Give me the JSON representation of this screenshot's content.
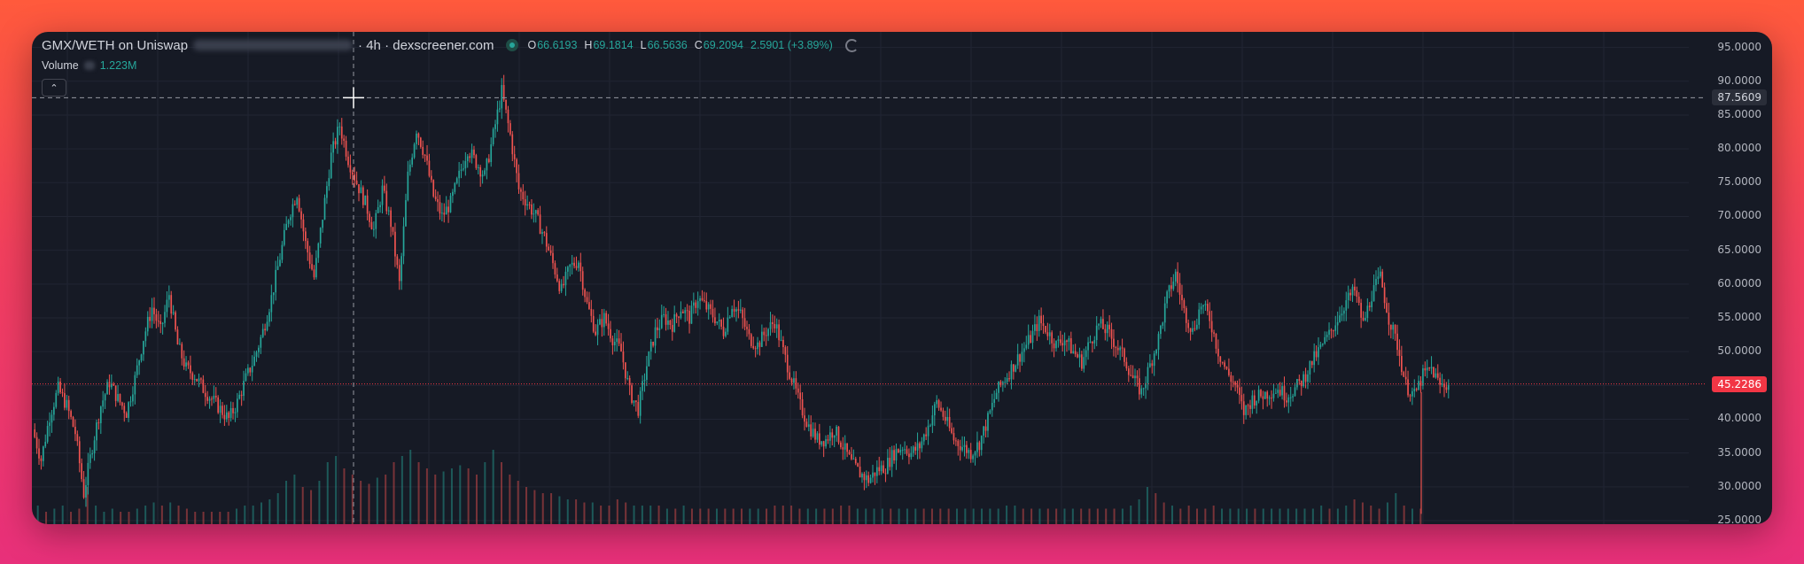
{
  "header": {
    "pair": "GMX/WETH on Uniswap",
    "timeframe": "4h",
    "source": "dexscreener.com",
    "ohlc": {
      "open_label": "O",
      "open": "66.6193",
      "high_label": "H",
      "high": "69.1814",
      "low_label": "L",
      "low": "66.5636",
      "close_label": "C",
      "close": "69.2094",
      "change": "2.5901 (+3.89%)"
    }
  },
  "volume": {
    "label": "Volume",
    "value": "1.223M"
  },
  "colors": {
    "up": "#26a69a",
    "down": "#ef5350",
    "background": "#161a25",
    "grid": "#212533",
    "price_line": "#f23645"
  },
  "crosshair_price": "87.5609",
  "last_price": "45.2286",
  "chart_data": {
    "type": "candlestick",
    "ylim": [
      25,
      96
    ],
    "y_ticks": [
      "95.0000",
      "90.0000",
      "85.0000",
      "80.0000",
      "75.0000",
      "70.0000",
      "65.0000",
      "60.0000",
      "55.0000",
      "50.0000",
      "45.0000",
      "40.0000",
      "35.0000",
      "30.0000",
      "25.0000"
    ],
    "series": [
      {
        "values": [
          38.5,
          34.0,
          40.5,
          44.5,
          42.0,
          38.0,
          29.0,
          36.0,
          42.0,
          45.5,
          43.0,
          41.0,
          46.0,
          52.0,
          56.5,
          53.0,
          58.5,
          51.0,
          47.5,
          46.5,
          44.5,
          43.0,
          41.5,
          40.0,
          42.5,
          46.0,
          49.0,
          53.0,
          58.0,
          64.0,
          70.0,
          73.5,
          66.0,
          61.0,
          70.0,
          79.0,
          83.5,
          78.5,
          75.0,
          72.0,
          68.0,
          74.0,
          69.0,
          60.0,
          76.0,
          83.0,
          79.0,
          73.0,
          70.0,
          72.0,
          76.0,
          80.0,
          78.0,
          76.0,
          82.0,
          88.5,
          82.0,
          74.0,
          72.0,
          70.0,
          67.0,
          63.0,
          59.0,
          62.5,
          63.5,
          57.0,
          53.0,
          55.0,
          52.0,
          50.0,
          44.0,
          41.5,
          48.0,
          53.0,
          55.0,
          54.0,
          56.5,
          55.0,
          58.0,
          56.5,
          55.0,
          53.0,
          57.0,
          55.5,
          52.0,
          51.0,
          53.0,
          54.5,
          50.0,
          46.0,
          42.0,
          39.0,
          37.0,
          37.0,
          38.5,
          36.0,
          33.5,
          32.0,
          31.0,
          32.5,
          33.0,
          35.0,
          36.0,
          35.0,
          36.0,
          39.0,
          42.5,
          40.0,
          37.0,
          36.0,
          35.0,
          36.5,
          40.0,
          44.0,
          46.0,
          48.0,
          50.0,
          52.0,
          54.5,
          53.0,
          51.0,
          52.0,
          50.0,
          48.5,
          51.5,
          54.0,
          53.0,
          51.0,
          49.0,
          46.0,
          44.0,
          48.0,
          52.0,
          58.0,
          61.5,
          56.0,
          53.0,
          57.0,
          55.0,
          50.0,
          47.0,
          45.0,
          41.0,
          43.0,
          43.5,
          44.0,
          44.5,
          43.5,
          44.5,
          46.0,
          48.5,
          50.5,
          52.5,
          55.0,
          57.5,
          59.0,
          54.0,
          58.5,
          61.0,
          55.0,
          51.0,
          45.0,
          43.5,
          46.5,
          47.5,
          45.0,
          45.2
        ]
      }
    ],
    "volume_values": [
      0.3,
      0.2,
      0.25,
      0.3,
      0.2,
      0.25,
      0.6,
      0.3,
      0.2,
      0.25,
      0.2,
      0.2,
      0.25,
      0.3,
      0.35,
      0.3,
      0.35,
      0.3,
      0.25,
      0.2,
      0.2,
      0.2,
      0.2,
      0.2,
      0.25,
      0.3,
      0.3,
      0.35,
      0.4,
      0.5,
      0.7,
      0.8,
      0.6,
      0.55,
      0.7,
      1.0,
      1.1,
      0.9,
      0.8,
      0.7,
      0.65,
      0.75,
      0.8,
      1.0,
      1.1,
      1.2,
      1.0,
      0.9,
      0.8,
      0.85,
      0.9,
      0.95,
      0.9,
      0.8,
      1.0,
      1.2,
      1.0,
      0.8,
      0.7,
      0.6,
      0.55,
      0.5,
      0.5,
      0.45,
      0.4,
      0.4,
      0.35,
      0.35,
      0.3,
      0.3,
      0.4,
      0.35,
      0.3,
      0.3,
      0.3,
      0.3,
      0.25,
      0.25,
      0.3,
      0.25,
      0.25,
      0.25,
      0.25,
      0.25,
      0.25,
      0.25,
      0.25,
      0.25,
      0.25,
      0.3,
      0.3,
      0.3,
      0.25,
      0.25,
      0.25,
      0.25,
      0.25,
      0.3,
      0.3,
      0.25,
      0.25,
      0.25,
      0.25,
      0.25,
      0.25,
      0.25,
      0.25,
      0.25,
      0.25,
      0.25,
      0.25,
      0.25,
      0.25,
      0.25,
      0.25,
      0.25,
      0.25,
      0.3,
      0.3,
      0.25,
      0.25,
      0.25,
      0.25,
      0.25,
      0.25,
      0.25,
      0.25,
      0.25,
      0.25,
      0.25,
      0.25,
      0.25,
      0.3,
      0.4,
      0.6,
      0.5,
      0.35,
      0.3,
      0.25,
      0.3,
      0.25,
      0.25,
      0.3,
      0.25,
      0.25,
      0.25,
      0.25,
      0.25,
      0.25,
      0.25,
      0.25,
      0.25,
      0.25,
      0.25,
      0.25,
      0.3,
      0.25,
      0.25,
      0.3,
      0.4,
      0.35,
      0.3,
      0.25,
      0.35,
      0.5,
      0.3,
      0.25,
      0.25
    ]
  }
}
